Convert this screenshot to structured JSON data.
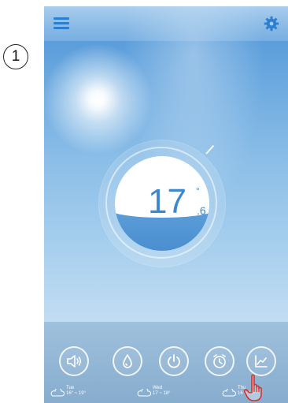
{
  "step": {
    "label": "1"
  },
  "temperature": {
    "integer": "17",
    "decimal": ".6",
    "degree_symbol": "°"
  },
  "forecast": [
    {
      "day": "Tue",
      "range": "16° ~ 19°"
    },
    {
      "day": "Wed",
      "range": "17 ~ 18°"
    },
    {
      "day": "Thu",
      "range": "16 ~ 18°"
    }
  ],
  "buttons": [
    {
      "icon": "speaker-icon"
    },
    {
      "icon": "drop-icon"
    },
    {
      "icon": "power-icon"
    },
    {
      "icon": "alarm-clock-icon"
    },
    {
      "icon": "chart-icon"
    }
  ],
  "colors": {
    "accent": "#2c7ed0",
    "temperature_text": "#3e88cf",
    "water_fill": "#4a8ed0",
    "cursor": "#d9302a"
  }
}
